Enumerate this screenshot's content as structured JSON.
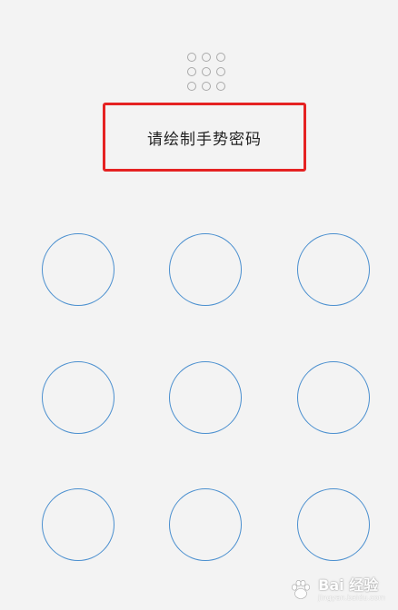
{
  "prompt": {
    "text": "请绘制手势密码"
  },
  "watermark": {
    "brand": "Bai 经验",
    "sub": "jingyan.baidu.com"
  },
  "colors": {
    "background": "#f3f3f3",
    "node_border": "#4a8fcf",
    "highlight_box": "#e52222",
    "preview_dot": "#a9a9a9"
  },
  "icons": {
    "pattern_preview": "grid-3x3-dots-icon",
    "watermark": "baidu-paw-icon"
  }
}
